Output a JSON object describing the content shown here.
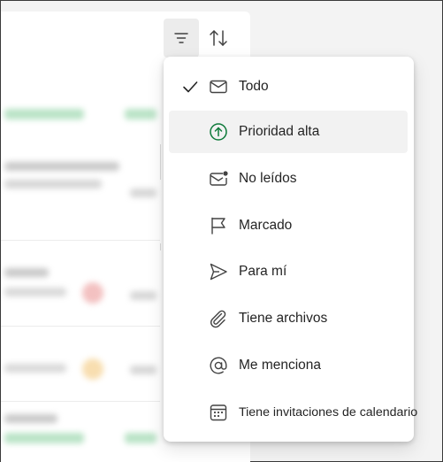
{
  "toolbar": {
    "filter_icon": "filter-icon",
    "sort_icon": "sort-icon"
  },
  "filter_menu": {
    "selected": "Todo",
    "items": [
      {
        "label": "Todo",
        "icon": "mail-icon",
        "checked": true
      },
      {
        "label": "Prioridad alta",
        "icon": "arrow-up-circle-icon",
        "checked": false
      },
      {
        "label": "No leídos",
        "icon": "mail-unread-icon",
        "checked": false
      },
      {
        "label": "Marcado",
        "icon": "flag-icon",
        "checked": false
      },
      {
        "label": "Para mí",
        "icon": "send-icon",
        "checked": false
      },
      {
        "label": "Tiene archivos",
        "icon": "paperclip-icon",
        "checked": false
      },
      {
        "label": "Me menciona",
        "icon": "mention-icon",
        "checked": false
      },
      {
        "label": "Tiene invitaciones de calendario",
        "icon": "calendar-icon",
        "checked": false
      }
    ]
  },
  "colors": {
    "accent_green": "#0e7a3a",
    "highlight_bg": "#f2f2f2",
    "menu_bg": "#ffffff"
  }
}
